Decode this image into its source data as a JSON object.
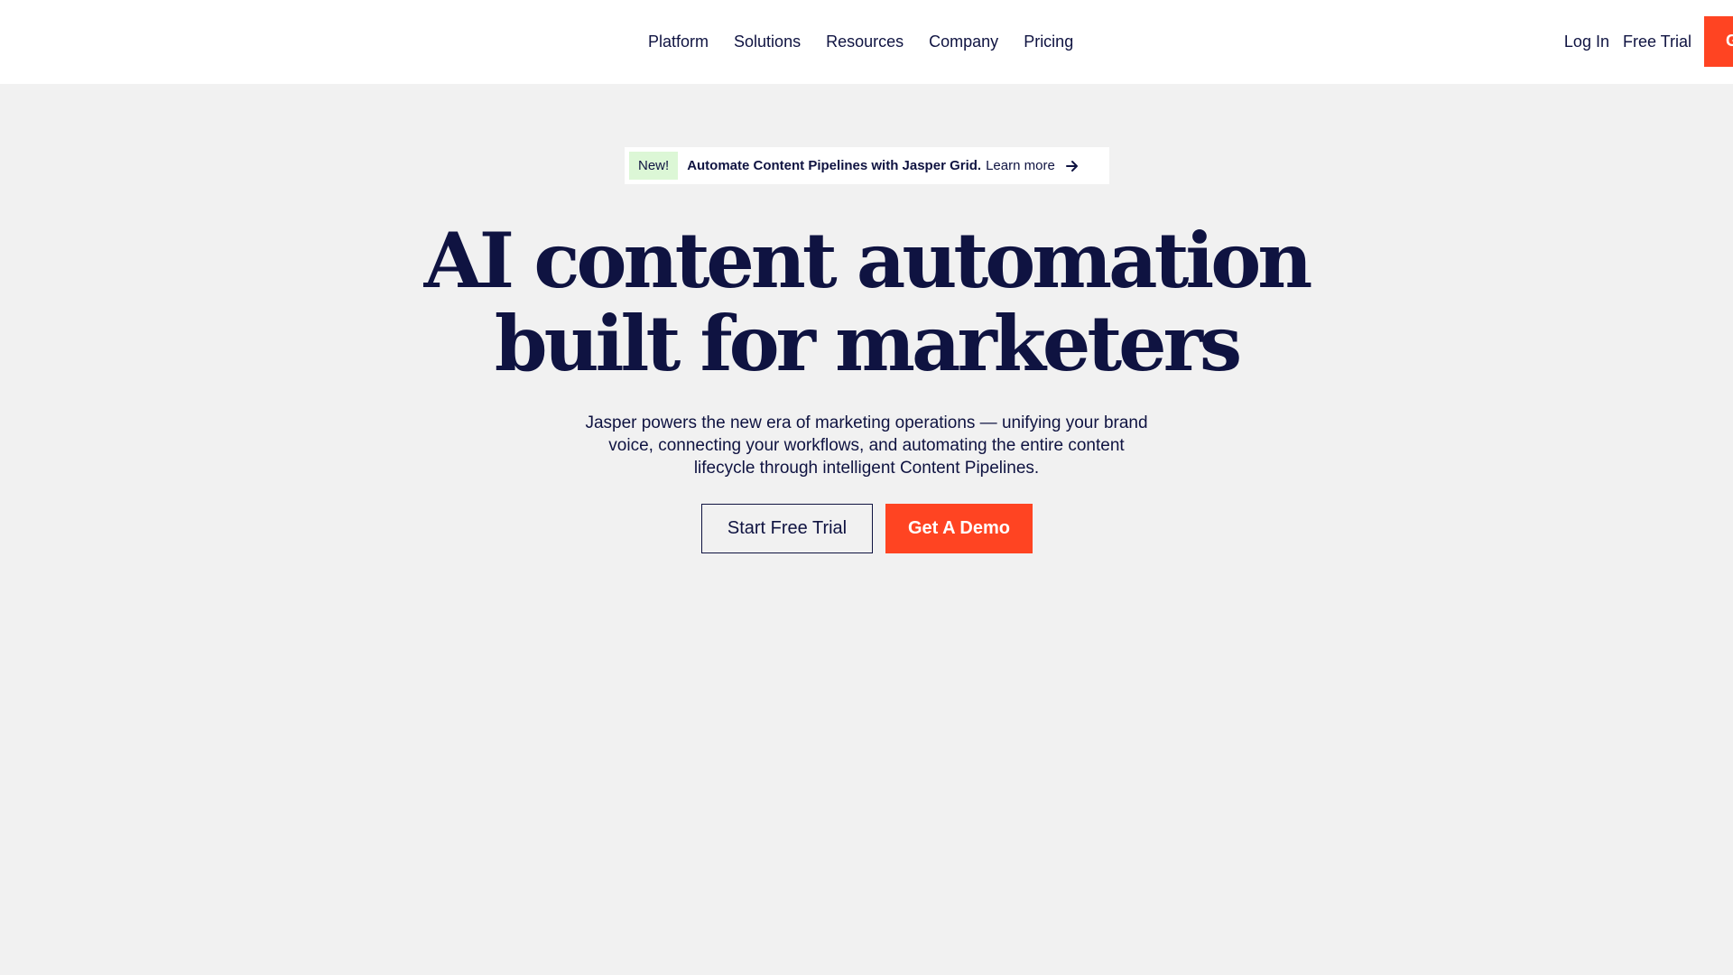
{
  "header": {
    "nav": [
      {
        "label": "Platform"
      },
      {
        "label": "Solutions"
      },
      {
        "label": "Resources"
      },
      {
        "label": "Company"
      },
      {
        "label": "Pricing"
      }
    ],
    "login_label": "Log In",
    "free_trial_label": "Free Trial",
    "cta_label": "G"
  },
  "announcement": {
    "badge": "New!",
    "text": "Automate Content Pipelines with Jasper Grid.",
    "link": "Learn more",
    "icon": "arrow-right-icon"
  },
  "hero": {
    "headline_line1": "AI content automation",
    "headline_line2": "built for marketers",
    "subtext": "Jasper powers the new era of marketing operations — unifying your brand voice, connecting your workflows, and automating the entire content lifecycle through intelligent Content Pipelines.",
    "primary_cta": "Start Free Trial",
    "secondary_cta": "Get A Demo"
  },
  "colors": {
    "accent": "#ff4422",
    "text": "#0f1341",
    "hero_bg": "#f1f1f1",
    "badge_bg": "#dcf7d6"
  }
}
